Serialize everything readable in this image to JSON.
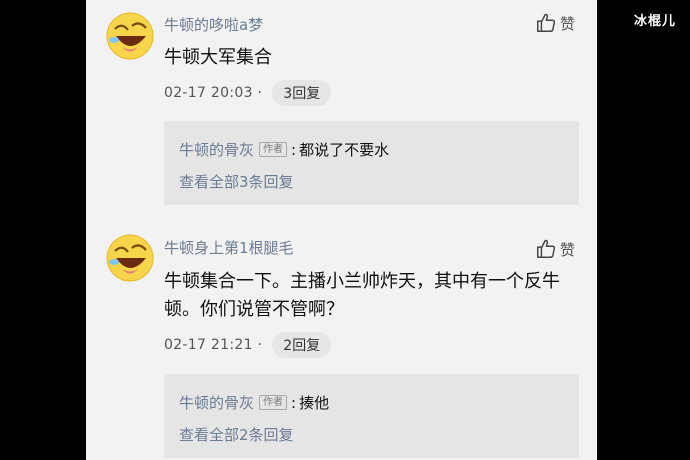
{
  "watermark": "冰棍儿",
  "comments": [
    {
      "username": "牛顿的哆啦a梦",
      "like_label": "赞",
      "content": "牛顿大军集合",
      "time": "02-17 20:03 ·",
      "reply_count": "3回复",
      "reply": {
        "user": "牛顿的骨灰",
        "badge": "作者",
        "sep": ":",
        "text": "都说了不要水",
        "view_all": "查看全部3条回复"
      }
    },
    {
      "username": "牛顿身上第1根腿毛",
      "like_label": "赞",
      "content": "牛顿集合一下。主播小兰帅炸天，其中有一个反牛顿。你们说管不管啊？",
      "time": "02-17 21:21 ·",
      "reply_count": "2回复",
      "reply": {
        "user": "牛顿的骨灰",
        "badge": "作者",
        "sep": ":",
        "text": "揍他",
        "view_all": "查看全部2条回复"
      }
    }
  ],
  "icons": {
    "avatar": "laughing-face-icon",
    "like": "thumbs-up-icon"
  },
  "colors": {
    "username": "#6b7c93",
    "reply_bg": "#e5e5e5",
    "panel_bg": "#f2f2f2"
  }
}
